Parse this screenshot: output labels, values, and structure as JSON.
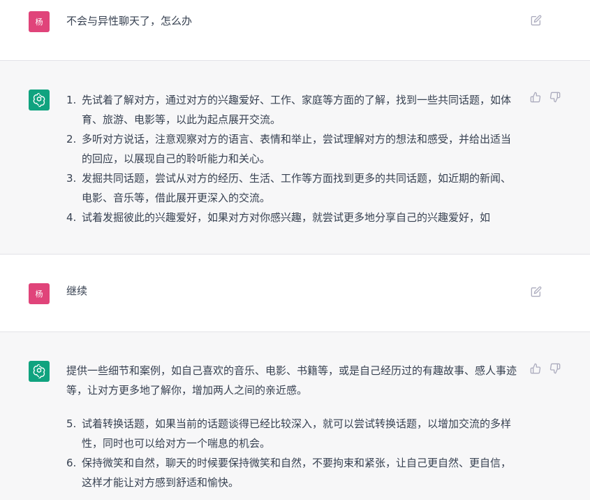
{
  "messages": [
    {
      "avatar": "杨",
      "text": "不会与异性聊天了，怎么办"
    },
    {
      "items": [
        {
          "num": "1.",
          "text": "先试着了解对方，通过对方的兴趣爱好、工作、家庭等方面的了解，找到一些共同话题，如体育、旅游、电影等，以此为起点展开交流。"
        },
        {
          "num": "2.",
          "text": "多听对方说话，注意观察对方的语言、表情和举止，尝试理解对方的想法和感受，并给出适当的回应，以展现自己的聆听能力和关心。"
        },
        {
          "num": "3.",
          "text": "发掘共同话题，尝试从对方的经历、生活、工作等方面找到更多的共同话题，如近期的新闻、电影、音乐等，借此展开更深入的交流。"
        },
        {
          "num": "4.",
          "text": "试着发掘彼此的兴趣爱好，如果对方对你感兴趣，就尝试更多地分享自己的兴趣爱好，如"
        }
      ]
    },
    {
      "avatar": "杨",
      "text": "继续"
    },
    {
      "paragraph": "提供一些细节和案例，如自己喜欢的音乐、电影、书籍等，或是自己经历过的有趣故事、感人事迹等，让对方更多地了解你，增加两人之间的亲近感。",
      "items": [
        {
          "num": "5.",
          "text": "试着转换话题，如果当前的话题谈得已经比较深入，就可以尝试转换话题，以增加交流的多样性，同时也可以给对方一个喘息的机会。"
        },
        {
          "num": "6.",
          "text": "保持微笑和自然，聊天的时候要保持微笑和自然，不要拘束和紧张，让自己更自然、更自信，这样才能让对方感到舒适和愉快。"
        }
      ]
    }
  ],
  "icons": {
    "edit": "edit-icon",
    "thumbs_up": "thumbs-up-icon",
    "thumbs_down": "thumbs-down-icon",
    "bot_logo": "openai-logo-icon"
  },
  "colors": {
    "user_avatar": "#e0447a",
    "bot_avatar": "#10a37f",
    "bot_bg": "#f7f7f8"
  }
}
